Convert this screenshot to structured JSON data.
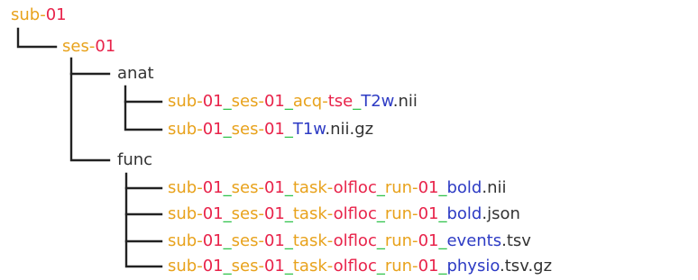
{
  "colors": {
    "orange": "#e8a21c",
    "red": "#e8234a",
    "green": "#2fc24a",
    "blue": "#2d3bc4",
    "black": "#333333",
    "line": "#222222"
  },
  "tree": {
    "root": {
      "parts": [
        {
          "text": "sub-",
          "color": "orange"
        },
        {
          "text": "01",
          "color": "red"
        }
      ]
    },
    "session": {
      "parts": [
        {
          "text": "ses-",
          "color": "orange"
        },
        {
          "text": "01",
          "color": "red"
        }
      ]
    },
    "anat": {
      "label": "anat",
      "files": [
        {
          "parts": [
            {
              "text": "sub-",
              "color": "orange"
            },
            {
              "text": "01",
              "color": "red"
            },
            {
              "text": "_",
              "color": "green"
            },
            {
              "text": "ses-",
              "color": "orange"
            },
            {
              "text": "01",
              "color": "red"
            },
            {
              "text": "_",
              "color": "green"
            },
            {
              "text": "acq-",
              "color": "orange"
            },
            {
              "text": "tse",
              "color": "red"
            },
            {
              "text": "_",
              "color": "green"
            },
            {
              "text": "T2w",
              "color": "blue"
            },
            {
              "text": ".nii",
              "color": "black"
            }
          ]
        },
        {
          "parts": [
            {
              "text": "sub-",
              "color": "orange"
            },
            {
              "text": "01",
              "color": "red"
            },
            {
              "text": "_",
              "color": "green"
            },
            {
              "text": "ses-",
              "color": "orange"
            },
            {
              "text": "01",
              "color": "red"
            },
            {
              "text": "_",
              "color": "green"
            },
            {
              "text": "T1w",
              "color": "blue"
            },
            {
              "text": ".nii.gz",
              "color": "black"
            }
          ]
        }
      ]
    },
    "func": {
      "label": "func",
      "files": [
        {
          "parts": [
            {
              "text": "sub-",
              "color": "orange"
            },
            {
              "text": "01",
              "color": "red"
            },
            {
              "text": "_",
              "color": "green"
            },
            {
              "text": "ses-",
              "color": "orange"
            },
            {
              "text": "01",
              "color": "red"
            },
            {
              "text": "_",
              "color": "green"
            },
            {
              "text": "task-",
              "color": "orange"
            },
            {
              "text": "olfloc",
              "color": "red"
            },
            {
              "text": "_",
              "color": "green"
            },
            {
              "text": "run-",
              "color": "orange"
            },
            {
              "text": "01",
              "color": "red"
            },
            {
              "text": "_",
              "color": "green"
            },
            {
              "text": "bold",
              "color": "blue"
            },
            {
              "text": ".nii",
              "color": "black"
            }
          ]
        },
        {
          "parts": [
            {
              "text": "sub-",
              "color": "orange"
            },
            {
              "text": "01",
              "color": "red"
            },
            {
              "text": "_",
              "color": "green"
            },
            {
              "text": "ses-",
              "color": "orange"
            },
            {
              "text": "01",
              "color": "red"
            },
            {
              "text": "_",
              "color": "green"
            },
            {
              "text": "task-",
              "color": "orange"
            },
            {
              "text": "olfloc",
              "color": "red"
            },
            {
              "text": "_",
              "color": "green"
            },
            {
              "text": "run-",
              "color": "orange"
            },
            {
              "text": "01",
              "color": "red"
            },
            {
              "text": "_",
              "color": "green"
            },
            {
              "text": "bold",
              "color": "blue"
            },
            {
              "text": ".json",
              "color": "black"
            }
          ]
        },
        {
          "parts": [
            {
              "text": "sub-",
              "color": "orange"
            },
            {
              "text": "01",
              "color": "red"
            },
            {
              "text": "_",
              "color": "green"
            },
            {
              "text": "ses-",
              "color": "orange"
            },
            {
              "text": "01",
              "color": "red"
            },
            {
              "text": "_",
              "color": "green"
            },
            {
              "text": "task-",
              "color": "orange"
            },
            {
              "text": "olfloc",
              "color": "red"
            },
            {
              "text": "_",
              "color": "green"
            },
            {
              "text": "run-",
              "color": "orange"
            },
            {
              "text": "01",
              "color": "red"
            },
            {
              "text": "_",
              "color": "green"
            },
            {
              "text": "events",
              "color": "blue"
            },
            {
              "text": ".tsv",
              "color": "black"
            }
          ]
        },
        {
          "parts": [
            {
              "text": "sub-",
              "color": "orange"
            },
            {
              "text": "01",
              "color": "red"
            },
            {
              "text": "_",
              "color": "green"
            },
            {
              "text": "ses-",
              "color": "orange"
            },
            {
              "text": "01",
              "color": "red"
            },
            {
              "text": "_",
              "color": "green"
            },
            {
              "text": "task-",
              "color": "orange"
            },
            {
              "text": "olfloc",
              "color": "red"
            },
            {
              "text": "_",
              "color": "green"
            },
            {
              "text": "run-",
              "color": "orange"
            },
            {
              "text": "01",
              "color": "red"
            },
            {
              "text": "_",
              "color": "green"
            },
            {
              "text": "physio",
              "color": "blue"
            },
            {
              "text": ".tsv.gz",
              "color": "black"
            }
          ]
        }
      ]
    }
  }
}
